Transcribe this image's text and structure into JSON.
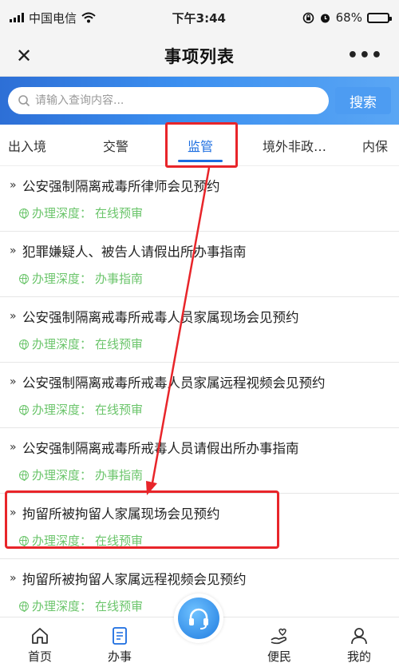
{
  "status_bar": {
    "carrier": "中国电信",
    "time": "下午3:44",
    "battery": "68%",
    "battery_level": 0.68
  },
  "nav": {
    "title": "事项列表",
    "close_label": "✕",
    "more_label": "•••"
  },
  "search": {
    "placeholder": "请输入查询内容...",
    "button_label": "搜索"
  },
  "tabs": [
    {
      "label": "出入境"
    },
    {
      "label": "交警"
    },
    {
      "label": "监管"
    },
    {
      "label": "境外非政…"
    },
    {
      "label": "内保"
    }
  ],
  "items": [
    {
      "title": "公安强制隔离戒毒所律师会见预约",
      "depth_label": "办理深度：",
      "depth_value": "在线预审"
    },
    {
      "title": "犯罪嫌疑人、被告人请假出所办事指南",
      "depth_label": "办理深度：",
      "depth_value": "办事指南"
    },
    {
      "title": "公安强制隔离戒毒所戒毒人员家属现场会见预约",
      "depth_label": "办理深度：",
      "depth_value": "在线预审"
    },
    {
      "title": "公安强制隔离戒毒所戒毒人员家属远程视频会见预约",
      "depth_label": "办理深度：",
      "depth_value": "在线预审"
    },
    {
      "title": "公安强制隔离戒毒所戒毒人员请假出所办事指南",
      "depth_label": "办理深度：",
      "depth_value": "办事指南"
    },
    {
      "title": "拘留所被拘留人家属现场会见预约",
      "depth_label": "办理深度：",
      "depth_value": "在线预审"
    },
    {
      "title": "拘留所被拘留人家属远程视频会见预约",
      "depth_label": "办理深度：",
      "depth_value": "在线预审"
    }
  ],
  "bottom_nav": [
    {
      "label": "首页",
      "icon": "home-icon"
    },
    {
      "label": "办事",
      "icon": "document-icon"
    },
    {
      "label": "便民",
      "icon": "hand-icon"
    },
    {
      "label": "我的",
      "icon": "user-icon"
    }
  ],
  "colors": {
    "accent": "#1a6ce0",
    "highlight": "#e8252a",
    "depth_text": "#6bc56b"
  }
}
